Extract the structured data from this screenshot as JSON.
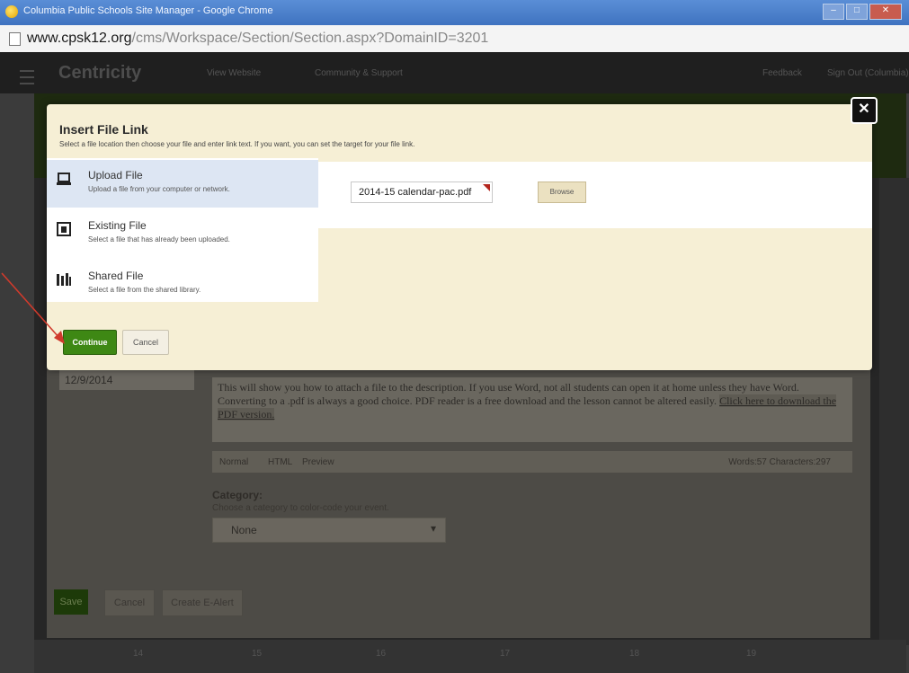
{
  "window": {
    "title": "Columbia Public Schools Site Manager - Google Chrome",
    "controls": [
      "–",
      "□",
      "✕"
    ]
  },
  "url": {
    "host": "www.cpsk12.org",
    "path": "/cms/Workspace/Section/Section.aspx?DomainID=3201"
  },
  "app_header": {
    "brand": "Centricity",
    "nav": [
      "View Website",
      "Community & Support",
      "Feedback",
      "Sign Out (Columbia)"
    ]
  },
  "modal": {
    "title": "Insert File Link",
    "subtitle": "Select a file location then choose your file and enter link text. If you want, you can set the target for your file link.",
    "options": [
      {
        "title": "Upload File",
        "desc": "Upload a file from your computer or network.",
        "icon": "laptop-icon",
        "selected": true
      },
      {
        "title": "Existing File",
        "desc": "Select a file that has already been uploaded.",
        "icon": "file-icon",
        "selected": false
      },
      {
        "title": "Shared File",
        "desc": "Select a file from the shared library.",
        "icon": "library-icon",
        "selected": false
      }
    ],
    "file_value": "2014-15 calendar-pac.pdf",
    "browse_label": "Browse",
    "continue_label": "Continue",
    "cancel_label": "Cancel",
    "close_label": "✕"
  },
  "form": {
    "date": "12/9/2014",
    "description": "This will show you how to attach a file to the description. If you use Word, not all students can open it at home unless they have Word. Converting to a .pdf is always a good choice. PDF reader is a free download and the lesson cannot be altered easily.",
    "description_link": "Click here to download the PDF version.",
    "editor_tabs": [
      "Normal",
      "HTML",
      "Preview"
    ],
    "editor_counts": "Words:57 Characters:297",
    "category_label": "Category:",
    "category_help": "Choose a category to color-code your event.",
    "category_value": "None",
    "save_label": "Save",
    "cancel_label": "Cancel",
    "email_label": "Create E-Alert"
  },
  "calendar_days": [
    "14",
    "15",
    "16",
    "17",
    "18",
    "19"
  ],
  "colors": {
    "accent": "#3e8814",
    "modal_bg": "#f6efd5",
    "selected_option": "#dde6f3"
  }
}
